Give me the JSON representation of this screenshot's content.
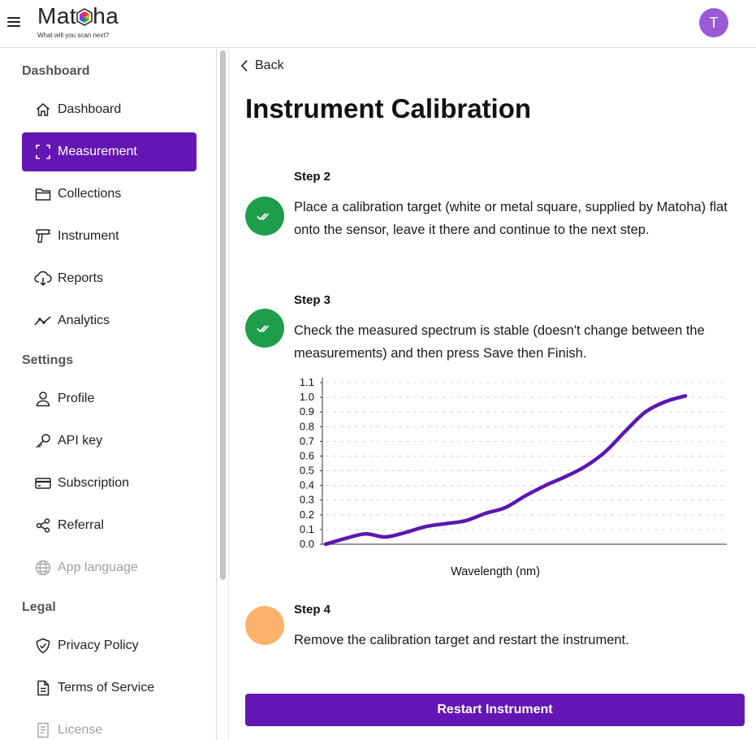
{
  "header": {
    "logo_text": "Matoha",
    "tagline": "What will you scan next?",
    "avatar_initial": "T"
  },
  "sidebar": {
    "sections": [
      {
        "heading": "Dashboard"
      },
      {
        "heading": "Settings"
      },
      {
        "heading": "Legal"
      }
    ],
    "items": [
      {
        "label": "Dashboard",
        "icon": "home-icon",
        "state": "normal"
      },
      {
        "label": "Measurement",
        "icon": "scan-icon",
        "state": "active"
      },
      {
        "label": "Collections",
        "icon": "folder-icon",
        "state": "normal"
      },
      {
        "label": "Instrument",
        "icon": "scanner-gun-icon",
        "state": "normal"
      },
      {
        "label": "Reports",
        "icon": "cloud-download-icon",
        "state": "normal"
      },
      {
        "label": "Analytics",
        "icon": "trend-line-icon",
        "state": "normal"
      },
      {
        "label": "Profile",
        "icon": "user-icon",
        "state": "normal"
      },
      {
        "label": "API key",
        "icon": "key-icon",
        "state": "normal"
      },
      {
        "label": "Subscription",
        "icon": "credit-card-icon",
        "state": "normal"
      },
      {
        "label": "Referral",
        "icon": "share-icon",
        "state": "normal"
      },
      {
        "label": "App language",
        "icon": "globe-icon",
        "state": "disabled"
      },
      {
        "label": "Privacy Policy",
        "icon": "shield-check-icon",
        "state": "normal"
      },
      {
        "label": "Terms of Service",
        "icon": "document-icon",
        "state": "normal"
      },
      {
        "label": "License",
        "icon": "license-icon",
        "state": "disabled"
      }
    ]
  },
  "main": {
    "back_label": "Back",
    "title": "Instrument Calibration",
    "steps": [
      {
        "title": "Step 2",
        "text": "Place a calibration target (white or metal square, supplied by Matoha) flat onto the sensor, leave it there and continue to the next step.",
        "status": "done"
      },
      {
        "title": "Step 3",
        "text": "Check the measured spectrum is stable (doesn't change between the measurements) and then press Save then Finish.",
        "status": "done"
      },
      {
        "title": "Step 4",
        "text": "Remove the calibration target and restart the instrument.",
        "status": "pending"
      }
    ],
    "restart_label": "Restart Instrument"
  },
  "colors": {
    "accent": "#6416b4",
    "done": "#1e9e4a",
    "pending": "#fdb26b",
    "avatar": "#9b59d6",
    "series": "#5b17b0"
  },
  "chart_data": {
    "type": "line",
    "xlabel": "Wavelength (nm)",
    "ylabel": "",
    "ylim": [
      0,
      1.1
    ],
    "yticks": [
      "0.0",
      "0.1",
      "0.2",
      "0.3",
      "0.4",
      "0.5",
      "0.6",
      "0.7",
      "0.8",
      "0.9",
      "1.0",
      "1.1"
    ],
    "x_tick_labels_visible": false,
    "grid": "horizontal-dashed",
    "series": [
      {
        "values": [
          0.0,
          0.04,
          0.07,
          0.05,
          0.08,
          0.12,
          0.14,
          0.16,
          0.21,
          0.25,
          0.33,
          0.4,
          0.46,
          0.53,
          0.63,
          0.77,
          0.9,
          0.97,
          1.01
        ]
      }
    ]
  }
}
